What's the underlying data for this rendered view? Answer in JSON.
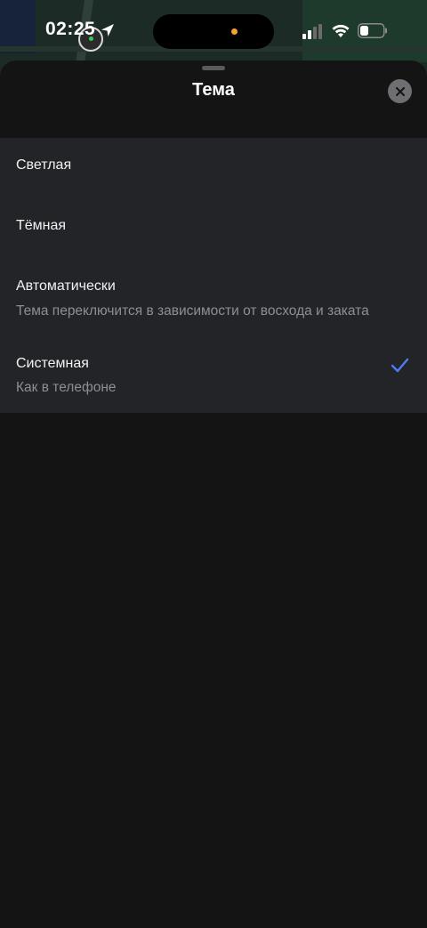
{
  "status_bar": {
    "time": "02:25"
  },
  "sheet": {
    "title": "Тема"
  },
  "options": [
    {
      "label": "Светлая",
      "subtitle": "",
      "selected": false
    },
    {
      "label": "Тёмная",
      "subtitle": "",
      "selected": false
    },
    {
      "label": "Автоматически",
      "subtitle": "Тема переключится в зависимости от восхода и заката",
      "selected": false
    },
    {
      "label": "Системная",
      "subtitle": "Как в телефоне",
      "selected": true
    }
  ],
  "colors": {
    "accent": "#4b7cf3",
    "sheet_background": "#141414",
    "list_background": "#232428"
  },
  "icons": {
    "close": "close-icon",
    "selected": "checkmark-icon",
    "location": "location-arrow-icon",
    "signal": "cellular-signal-icon",
    "wifi": "wifi-icon",
    "battery": "battery-icon"
  }
}
